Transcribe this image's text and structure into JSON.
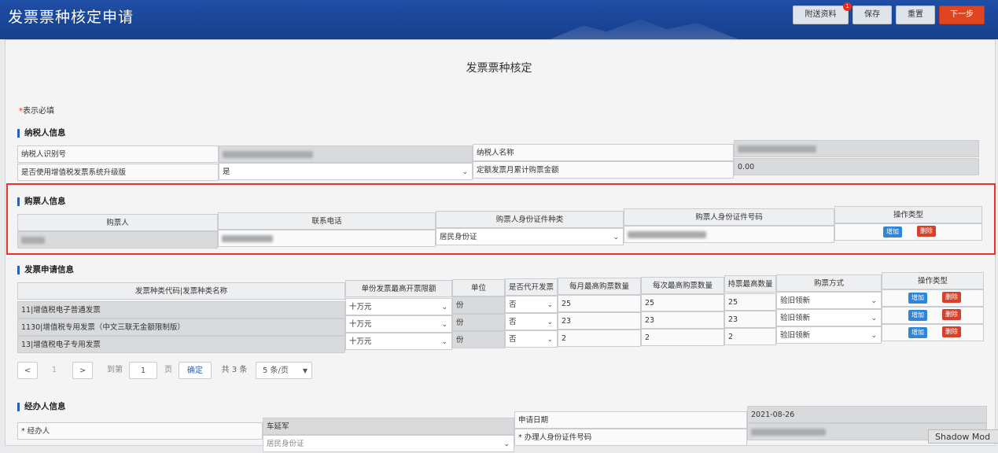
{
  "header": {
    "title": "发票票种核定申请",
    "badge": "1",
    "buttons": {
      "attach": "附送资料",
      "save": "保存",
      "reset": "重置",
      "next": "下一步"
    }
  },
  "page_title": "发票票种核定",
  "required_note": {
    "star": "*",
    "text": "表示必填"
  },
  "taxpayer": {
    "section": "纳税人信息",
    "id_label": "纳税人识别号",
    "name_label": "纳税人名称",
    "upgrade_label": "是否使用增值税发票系统升级版",
    "upgrade_value": "是",
    "fixed_amount_label": "定额发票月累计购票金额",
    "fixed_amount_value": "0.00"
  },
  "buyer": {
    "section": "购票人信息",
    "headers": [
      "购票人",
      "联系电话",
      "购票人身份证件种类",
      "购票人身份证件号码",
      "操作类型"
    ],
    "id_type_value": "居民身份证",
    "add": "增加",
    "delete": "删除"
  },
  "invoice": {
    "section": "发票申请信息",
    "headers": [
      "发票种类代码|发票种类名称",
      "单份发票最高开票限额",
      "单位",
      "是否代开发票",
      "每月最高购票数量",
      "每次最高购票数量",
      "持票最高数量",
      "购票方式",
      "操作类型"
    ],
    "rows": [
      {
        "name": "11|增值税电子普通发票",
        "limit": "十万元",
        "unit": "份",
        "agent": "否",
        "monthly": "25",
        "each": "25",
        "hold": "25",
        "method": "验旧领新",
        "add": "增加",
        "del": "删除"
      },
      {
        "name": "1130|增值税专用发票（中文三联无金额限制版）",
        "limit": "十万元",
        "unit": "份",
        "agent": "否",
        "monthly": "23",
        "each": "23",
        "hold": "23",
        "method": "验旧领新",
        "add": "增加",
        "del": "删除"
      },
      {
        "name": "13|增值税电子专用发票",
        "limit": "十万元",
        "unit": "份",
        "agent": "否",
        "monthly": "2",
        "each": "2",
        "hold": "2",
        "method": "验旧领新",
        "add": "增加",
        "del": "删除"
      }
    ]
  },
  "pagination": {
    "prev": "<",
    "page": "1",
    "next": ">",
    "goto": "到第",
    "input": "1",
    "page_unit": "页",
    "confirm": "确定",
    "total": "共 3 条",
    "per_page": "5 条/页"
  },
  "agent": {
    "section": "经办人信息",
    "agent_label": "* 经办人",
    "agent_value": "车延军",
    "date_label": "申请日期",
    "date_value": "2021-08-26",
    "id_number_label": "* 办理人身份证件号码",
    "id_type_partial": "居民身份证"
  },
  "shadow_text": "Shadow Mod"
}
